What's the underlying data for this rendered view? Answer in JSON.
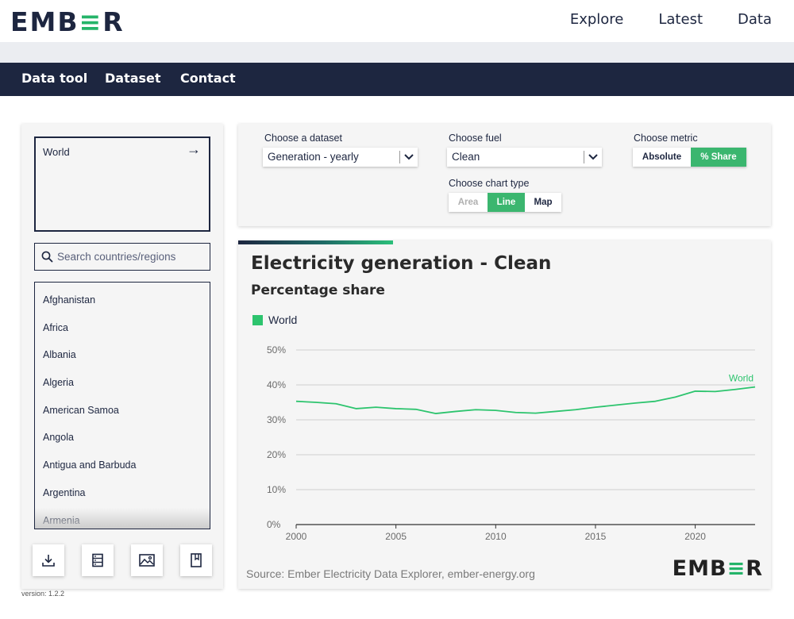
{
  "brand": {
    "logo_text": "EMBER"
  },
  "top_nav": [
    "Explore",
    "Latest",
    "Data"
  ],
  "sub_nav": [
    "Data tool",
    "Dataset",
    "Contact"
  ],
  "sidebar": {
    "selected_region": "World",
    "search": {
      "placeholder": "Search countries/regions"
    },
    "countries": [
      "Afghanistan",
      "Africa",
      "Albania",
      "Algeria",
      "American Samoa",
      "Angola",
      "Antigua and Barbuda",
      "Argentina",
      "Armenia"
    ],
    "tools": [
      "download-icon",
      "database-icon",
      "image-icon",
      "bookmark-icon"
    ],
    "version": "version: 1.2.2"
  },
  "controls": {
    "dataset": {
      "label": "Choose a dataset",
      "value": "Generation - yearly"
    },
    "fuel": {
      "label": "Choose fuel",
      "value": "Clean"
    },
    "metric": {
      "label": "Choose metric",
      "options": [
        "Absolute",
        "% Share"
      ],
      "selected": "% Share"
    },
    "chart_type": {
      "label": "Choose chart type",
      "options": [
        "Area",
        "Line",
        "Map"
      ],
      "selected": "Line"
    }
  },
  "chart": {
    "title": "Electricity generation - Clean",
    "subtitle": "Percentage share",
    "legend": "World",
    "source": "Source: Ember Electricity Data Explorer, ember-energy.org",
    "footer_logo": "EMBER"
  },
  "colors": {
    "navy": "#1d2640",
    "accent_green": "#3bb66f",
    "line_green": "#2dc46e"
  },
  "chart_data": {
    "type": "line",
    "title": "Electricity generation - Clean",
    "subtitle": "Percentage share",
    "xlabel": "",
    "ylabel": "",
    "ylim": [
      0,
      50
    ],
    "y_ticks": [
      "0%",
      "10%",
      "20%",
      "30%",
      "40%",
      "50%"
    ],
    "y_tick_values": [
      0,
      10,
      20,
      30,
      40,
      50
    ],
    "x_ticks": [
      "2000",
      "2005",
      "2010",
      "2015",
      "2020"
    ],
    "x_tick_values": [
      2000,
      2005,
      2010,
      2015,
      2020
    ],
    "xlim": [
      2000,
      2023
    ],
    "legend_position": "top-left",
    "grid": true,
    "x": [
      2000,
      2001,
      2002,
      2003,
      2004,
      2005,
      2006,
      2007,
      2008,
      2009,
      2010,
      2011,
      2012,
      2013,
      2014,
      2015,
      2016,
      2017,
      2018,
      2019,
      2020,
      2021,
      2022,
      2023
    ],
    "series": [
      {
        "name": "World",
        "color": "#2dc46e",
        "values": [
          35.3,
          35.0,
          34.6,
          33.2,
          33.6,
          33.2,
          33.0,
          31.8,
          32.4,
          32.9,
          32.7,
          32.1,
          31.9,
          32.4,
          32.9,
          33.6,
          34.2,
          34.8,
          35.3,
          36.5,
          38.2,
          38.1,
          38.7,
          39.4
        ]
      }
    ]
  }
}
